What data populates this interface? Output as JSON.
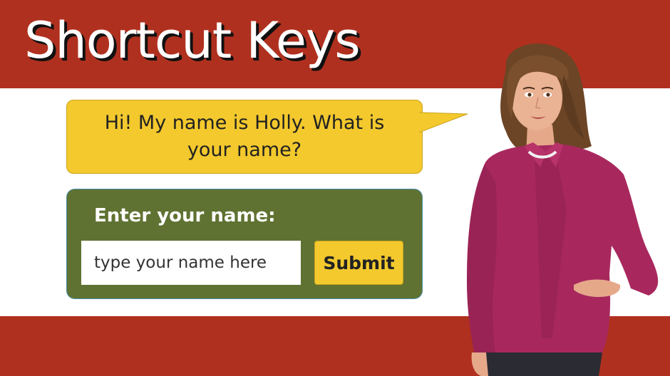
{
  "slide": {
    "title": "Shortcut Keys"
  },
  "bubble": {
    "text": "Hi! My name is Holly.  What is your name?"
  },
  "form": {
    "label": "Enter your name:",
    "input_value": "",
    "input_placeholder": "type your name here",
    "submit_label": "Submit"
  },
  "icons": {
    "character": "holly-character-icon"
  },
  "colors": {
    "band": "#b0301f",
    "bubble": "#f3c92d",
    "panel": "#5f7232",
    "shirt": "#a8285e"
  }
}
